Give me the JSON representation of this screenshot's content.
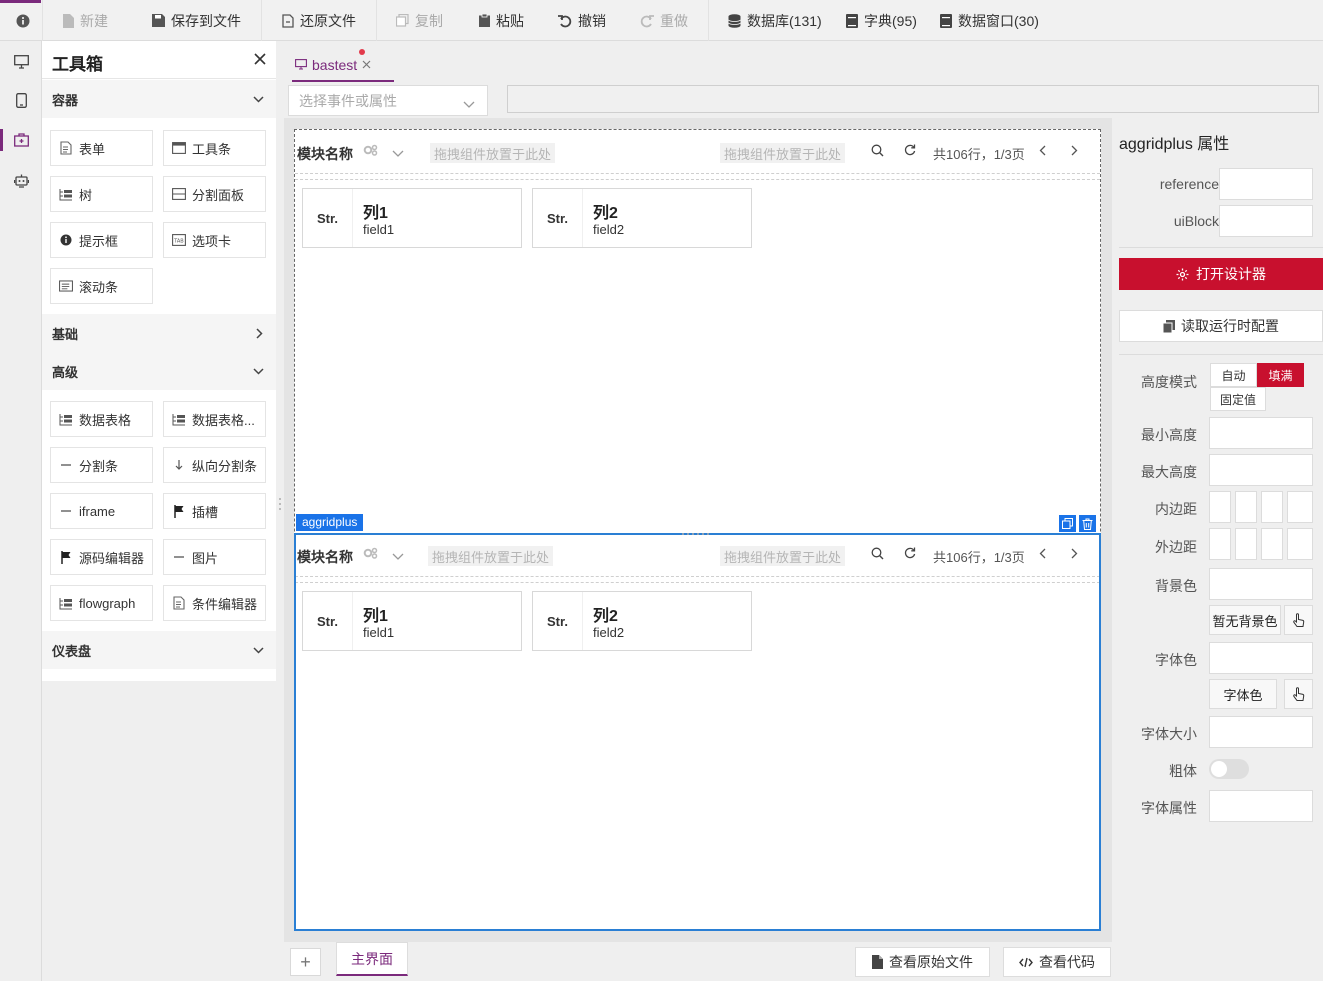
{
  "toolbar": {
    "info_icon": "info-icon",
    "new_label": "新建",
    "save_label": "保存到文件",
    "restore_label": "还原文件",
    "copy_label": "复制",
    "paste_label": "粘贴",
    "undo_label": "撤销",
    "redo_label": "重做",
    "database_label": "数据库(131)",
    "dictionary_label": "字典(95)",
    "data_window_label": "数据窗口(30)"
  },
  "rail": [
    "desktop-icon",
    "mobile-icon",
    "toolbox-icon",
    "robot-icon"
  ],
  "toolbox": {
    "title": "工具箱",
    "sections": {
      "container": "容器",
      "basic": "基础",
      "advanced": "高级",
      "dashboard": "仪表盘"
    },
    "container_items": [
      "表单",
      "工具条",
      "树",
      "分割面板",
      "提示框",
      "选项卡",
      "滚动条"
    ],
    "advanced_items": [
      "数据表格",
      "数据表格...",
      "分割条",
      "纵向分割条",
      "iframe",
      "插槽",
      "源码编辑器",
      "图片",
      "flowgraph",
      "条件编辑器"
    ]
  },
  "tab": {
    "label": "bastest"
  },
  "event_select": {
    "placeholder": "选择事件或属性"
  },
  "block": {
    "title": "模块名称",
    "drop_hint": "拖拽组件放置于此处",
    "pager": "共106行，1/3页",
    "columns": [
      {
        "type": "Str.",
        "name": "列1",
        "field": "field1"
      },
      {
        "type": "Str.",
        "name": "列2",
        "field": "field2"
      }
    ]
  },
  "selection": {
    "tag": "aggridplus"
  },
  "bottom": {
    "add": "+",
    "main_tab": "主界面",
    "view_source": "查看原始文件",
    "view_code": "查看代码"
  },
  "props": {
    "title": "aggridplus 属性",
    "reference_label": "reference",
    "uiblock_label": "uiBlock",
    "designer_btn": "打开设计器",
    "read_config_btn": "读取运行时配置",
    "height_mode_label": "高度模式",
    "height_modes": [
      "自动",
      "填满",
      "固定值"
    ],
    "height_mode_selected": "填满",
    "min_height_label": "最小高度",
    "max_height_label": "最大高度",
    "padding_label": "内边距",
    "margin_label": "外边距",
    "bg_label": "背景色",
    "bg_btn": "暂无背景色",
    "font_color_label": "字体色",
    "font_color_btn": "字体色",
    "font_size_label": "字体大小",
    "bold_label": "粗体",
    "font_prop_label": "字体属性",
    "bold_on": false
  },
  "colors": {
    "accent": "#7b2a7c",
    "primary": "#c8102e",
    "selection": "#1a73e8"
  }
}
